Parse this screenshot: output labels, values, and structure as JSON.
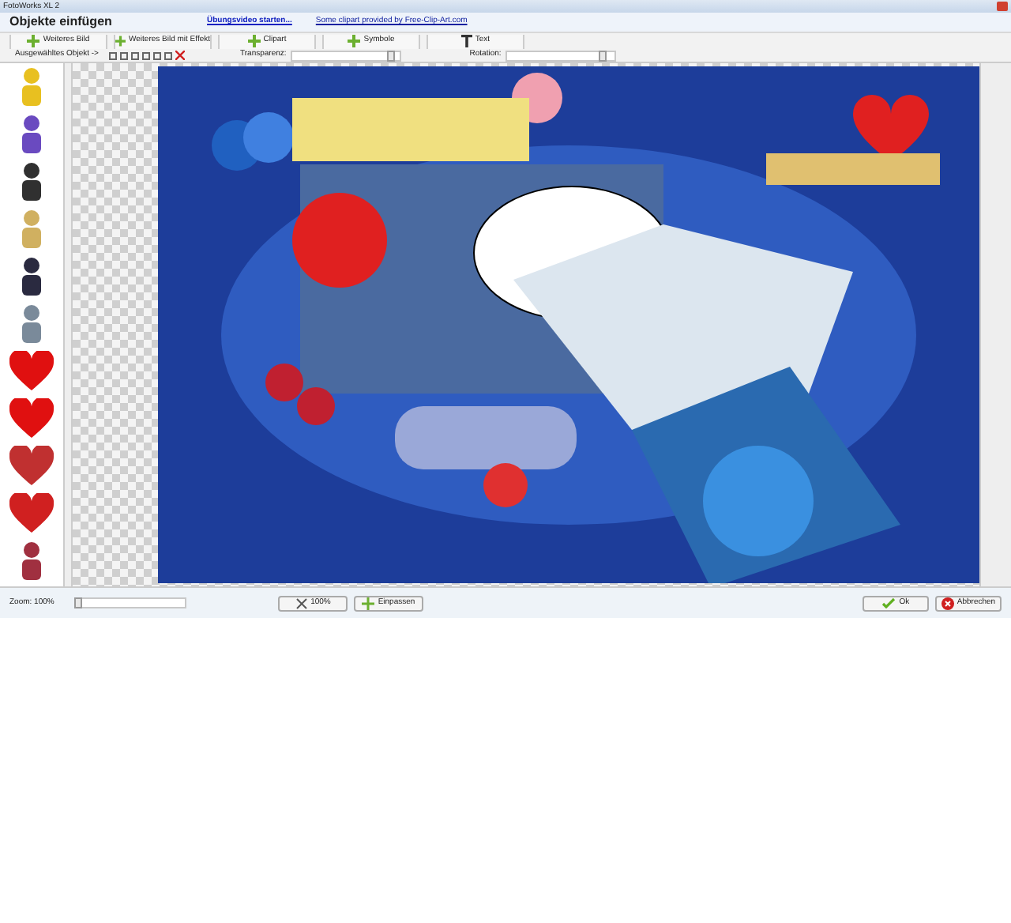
{
  "window": {
    "title": "FotoWorks XL 2"
  },
  "header": {
    "title": "Objekte einfügen",
    "links": [
      "Übungsvideo starten...",
      "Some clipart provided by Free-Clip-Art.com"
    ]
  },
  "toolbar": {
    "buttons": [
      {
        "label": "Weiteres Bild",
        "kind": "add"
      },
      {
        "label": "Weiteres Bild mit Effekt",
        "kind": "add"
      },
      {
        "label": "Clipart",
        "kind": "add"
      },
      {
        "label": "Symbole",
        "kind": "add"
      },
      {
        "label": "Text",
        "kind": "text"
      }
    ]
  },
  "object_bar": {
    "label": "Ausgewähltes Objekt ->",
    "transparency": {
      "label": "Transparenz:",
      "level": 0.92
    },
    "rotation": {
      "label": "Rotation:",
      "level": 0.9
    }
  },
  "clipart_list": [
    {
      "kind": "clipart",
      "color": "#e8c020"
    },
    {
      "kind": "clipart",
      "color": "#6a4ac0"
    },
    {
      "kind": "clipart",
      "color": "#303030"
    },
    {
      "kind": "clipart",
      "color": "#d0b060"
    },
    {
      "kind": "clipart",
      "color": "#2a2a40"
    },
    {
      "kind": "clipart",
      "color": "#7a8a9a"
    },
    {
      "kind": "heart",
      "color": "#e01010"
    },
    {
      "kind": "heart",
      "color": "#e01010"
    },
    {
      "kind": "heart",
      "color": "#c03030"
    },
    {
      "kind": "heart",
      "color": "#d02020"
    },
    {
      "kind": "clipart",
      "color": "#a03040"
    }
  ],
  "status_bar": {
    "zoom": {
      "label": "Zoom: 100%",
      "level": 0.02
    },
    "buttons": [
      {
        "label": "100%",
        "kind": "fit"
      },
      {
        "label": "Einpassen",
        "kind": "expand"
      }
    ],
    "dialog_buttons": [
      {
        "label": "Ok",
        "kind": "ok"
      },
      {
        "label": "Abbrechen",
        "kind": "cancel"
      }
    ]
  }
}
